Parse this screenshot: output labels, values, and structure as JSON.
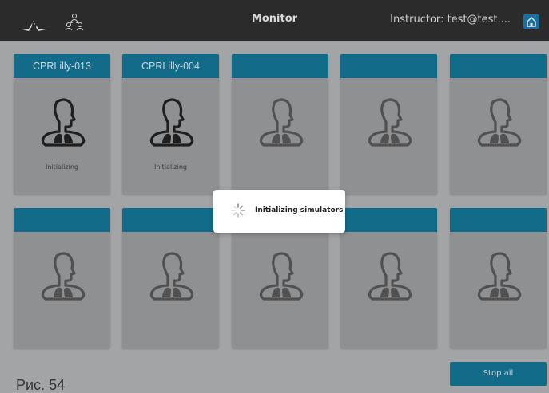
{
  "header": {
    "title": "Monitor",
    "instructor_label": "Instructor: test@test...."
  },
  "cards": [
    {
      "name": "CPRLilly-013",
      "status": "Initializing"
    },
    {
      "name": "CPRLilly-004",
      "status": "Initializing"
    },
    {
      "name": "",
      "status": ""
    },
    {
      "name": "",
      "status": ""
    },
    {
      "name": "",
      "status": ""
    },
    {
      "name": "",
      "status": ""
    },
    {
      "name": "",
      "status": ""
    },
    {
      "name": "",
      "status": ""
    },
    {
      "name": "",
      "status": ""
    },
    {
      "name": "",
      "status": ""
    }
  ],
  "dialog": {
    "message": "Initializing simulators"
  },
  "footer": {
    "stop_all_label": "Stop all",
    "figure_caption": "Рис. 54"
  },
  "colors": {
    "topbar": "#2b2b2c",
    "accent": "#126b88",
    "overlay_bg": "#a3a4a6",
    "card_bg": "#8f9092"
  },
  "icons": {
    "logo": "3b-logo-icon",
    "users": "users-network-icon",
    "home": "home-icon",
    "simulator": "torso-lungs-icon",
    "spinner": "loading-spinner-icon"
  }
}
